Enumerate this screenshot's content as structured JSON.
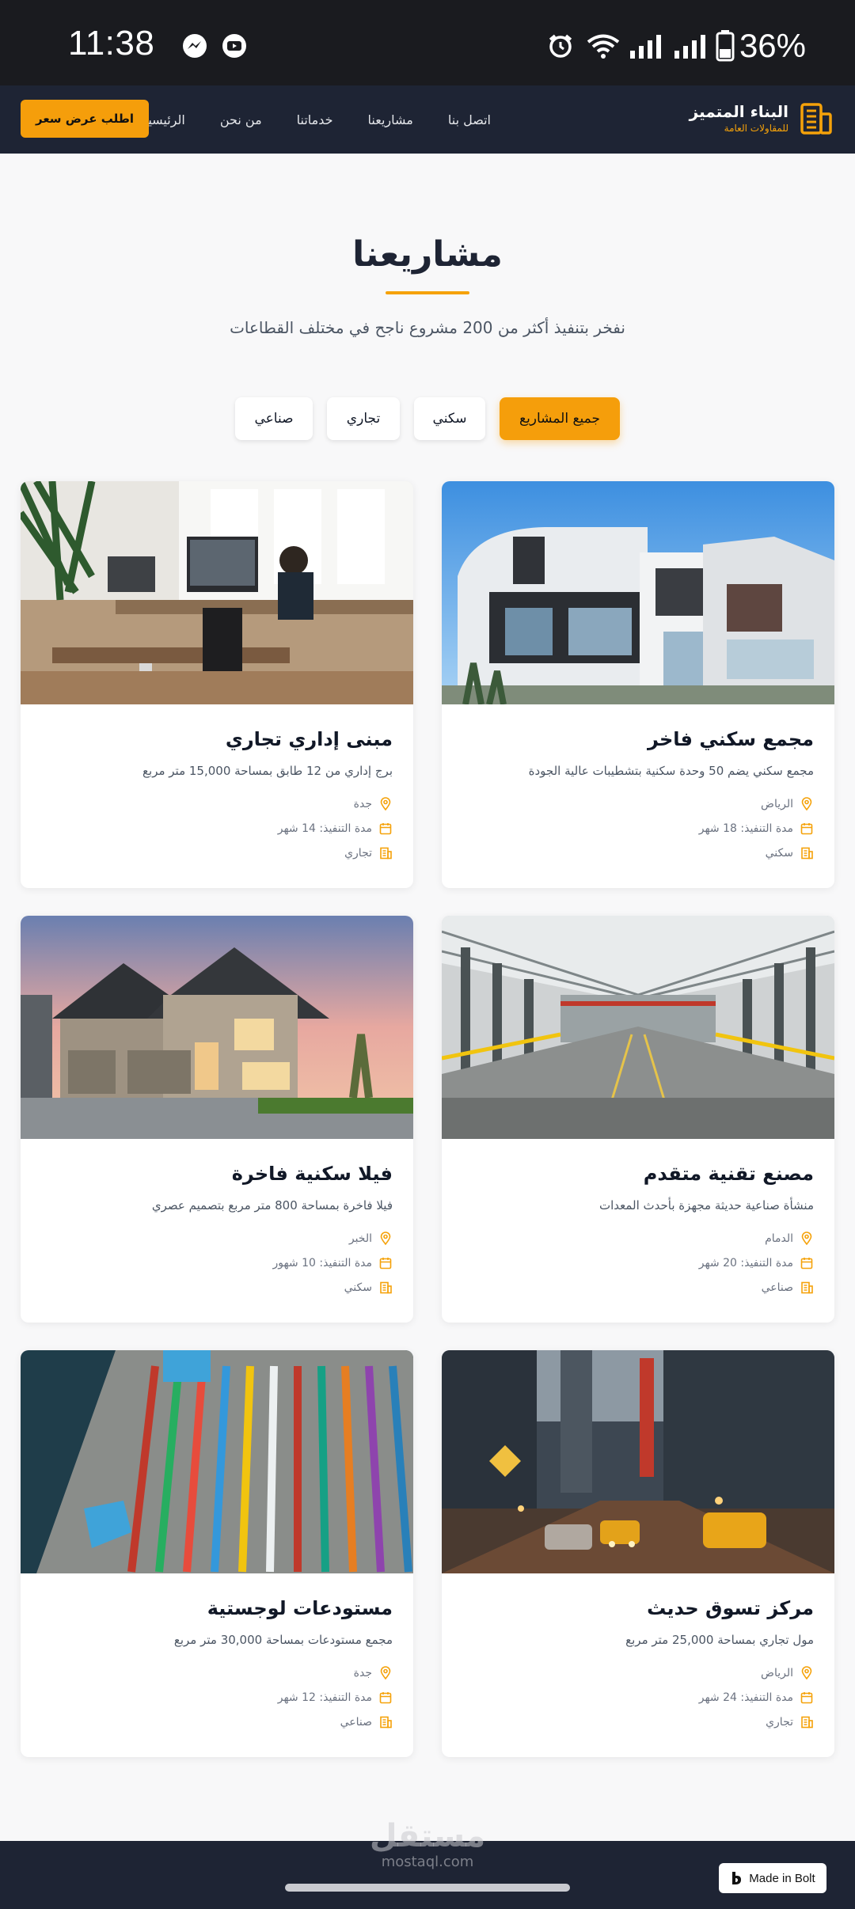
{
  "status_bar": {
    "time": "11:38",
    "battery": "36%",
    "icons": [
      "messenger-icon",
      "youtube-icon",
      "alarm-icon",
      "wifi-icon",
      "signal-icon",
      "signal-icon",
      "battery-icon"
    ]
  },
  "navbar": {
    "brand_title": "البناء المتميز",
    "brand_subtitle": "للمقاولات العامة",
    "links": [
      "الرئيسية",
      "من نحن",
      "خدماتنا",
      "مشاريعنا",
      "اتصل بنا"
    ],
    "cta": "اطلب عرض سعر"
  },
  "colors": {
    "accent": "#f59e0b",
    "navy": "#1e2434"
  },
  "section": {
    "title": "مشاريعنا",
    "subtitle": "نفخر بتنفيذ أكثر من 200 مشروع ناجح في مختلف القطاعات"
  },
  "filters": [
    "جميع المشاريع",
    "سكني",
    "تجاري",
    "صناعي"
  ],
  "active_filter": "جميع المشاريع",
  "projects": [
    {
      "title": "مجمع سكني فاخر",
      "desc": "مجمع سكني يضم 50 وحدة سكنية بتشطيبات عالية الجودة",
      "location": "الرياض",
      "duration": "مدة التنفيذ: 18 شهر",
      "category": "سكني"
    },
    {
      "title": "مبنى إداري تجاري",
      "desc": "برج إداري من 12 طابق بمساحة 15,000 متر مربع",
      "location": "جدة",
      "duration": "مدة التنفيذ: 14 شهر",
      "category": "تجاري"
    },
    {
      "title": "مصنع تقنية متقدم",
      "desc": "منشأة صناعية حديثة مجهزة بأحدث المعدات",
      "location": "الدمام",
      "duration": "مدة التنفيذ: 20 شهر",
      "category": "صناعي"
    },
    {
      "title": "فيلا سكنية فاخرة",
      "desc": "فيلا فاخرة بمساحة 800 متر مربع بتصميم عصري",
      "location": "الخبر",
      "duration": "مدة التنفيذ: 10 شهور",
      "category": "سكني"
    },
    {
      "title": "مركز تسوق حديث",
      "desc": "مول تجاري بمساحة 25,000 متر مربع",
      "location": "الرياض",
      "duration": "مدة التنفيذ: 24 شهر",
      "category": "تجاري"
    },
    {
      "title": "مستودعات لوجستية",
      "desc": "مجمع مستودعات بمساحة 30,000 متر مربع",
      "location": "جدة",
      "duration": "مدة التنفيذ: 12 شهر",
      "category": "صناعي"
    }
  ],
  "watermark": {
    "arabic": "مستقل",
    "latin": "mostaql.com"
  },
  "badge": "Made in Bolt"
}
